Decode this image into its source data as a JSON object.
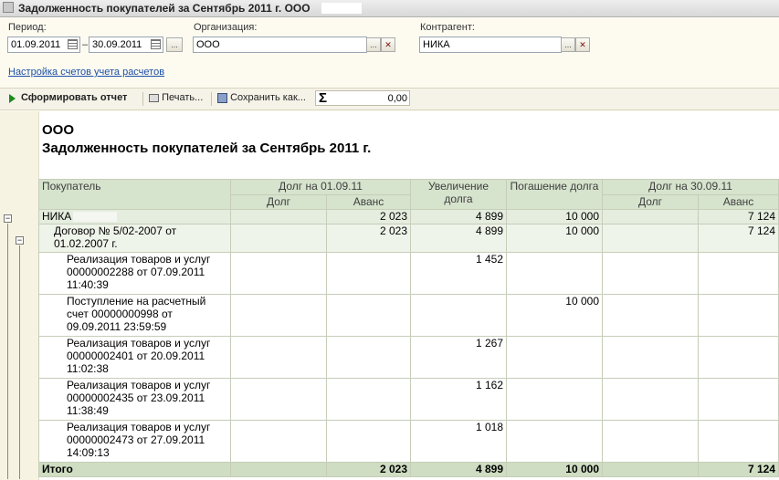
{
  "window": {
    "title": "Задолженность покупателей за Сентябрь 2011 г. ООО"
  },
  "filters": {
    "period_label": "Период:",
    "date_from": "01.09.2011",
    "date_sep": "–",
    "date_to": "30.09.2011",
    "more_button": "...",
    "org_label": "Организация:",
    "org_value": "ООО",
    "contractor_label": "Контрагент:",
    "contractor_value": "НИКА",
    "select_button": "...",
    "clear_button": "✕",
    "settings_link": "Настройка счетов учета расчетов"
  },
  "toolbar": {
    "generate_label": "Сформировать отчет",
    "print_label": "Печать...",
    "save_label": "Сохранить как...",
    "sum_symbol": "Σ",
    "sum_value": "0,00"
  },
  "report": {
    "org_name": "ООО",
    "title": "Задолженность покупателей за Сентябрь 2011 г.",
    "headers": {
      "buyer": "Покупатель",
      "debt_start": "Долг на 01.09.11",
      "increase": "Увеличение долга",
      "repayment": "Погашение долга",
      "debt_end": "Долг на 30.09.11",
      "debt": "Долг",
      "advance": "Аванс"
    },
    "rows": [
      {
        "label": "НИКА",
        "debt_start_debt": "",
        "debt_start_advance": "2 023",
        "increase": "4 899",
        "repayment": "10 000",
        "debt_end_debt": "",
        "debt_end_advance": "7 124"
      },
      {
        "label": "Договор № 5/02-2007 от 01.02.2007 г.",
        "debt_start_debt": "",
        "debt_start_advance": "2 023",
        "increase": "4 899",
        "repayment": "10 000",
        "debt_end_debt": "",
        "debt_end_advance": "7 124"
      },
      {
        "label": "Реализация товаров и услуг 00000002288 от 07.09.2011 11:40:39",
        "debt_start_debt": "",
        "debt_start_advance": "",
        "increase": "1 452",
        "repayment": "",
        "debt_end_debt": "",
        "debt_end_advance": ""
      },
      {
        "label": "Поступление на расчетный счет 00000000998 от 09.09.2011 23:59:59",
        "debt_start_debt": "",
        "debt_start_advance": "",
        "increase": "",
        "repayment": "10 000",
        "debt_end_debt": "",
        "debt_end_advance": ""
      },
      {
        "label": "Реализация товаров и услуг 00000002401 от 20.09.2011 11:02:38",
        "debt_start_debt": "",
        "debt_start_advance": "",
        "increase": "1 267",
        "repayment": "",
        "debt_end_debt": "",
        "debt_end_advance": ""
      },
      {
        "label": "Реализация товаров и услуг 00000002435 от 23.09.2011 11:38:49",
        "debt_start_debt": "",
        "debt_start_advance": "",
        "increase": "1 162",
        "repayment": "",
        "debt_end_debt": "",
        "debt_end_advance": ""
      },
      {
        "label": "Реализация товаров и услуг 00000002473 от 27.09.2011 14:09:13",
        "debt_start_debt": "",
        "debt_start_advance": "",
        "increase": "1 018",
        "repayment": "",
        "debt_end_debt": "",
        "debt_end_advance": ""
      }
    ],
    "total": {
      "label": "Итого",
      "debt_start_debt": "",
      "debt_start_advance": "2 023",
      "increase": "4 899",
      "repayment": "10 000",
      "debt_end_debt": "",
      "debt_end_advance": "7 124"
    }
  }
}
